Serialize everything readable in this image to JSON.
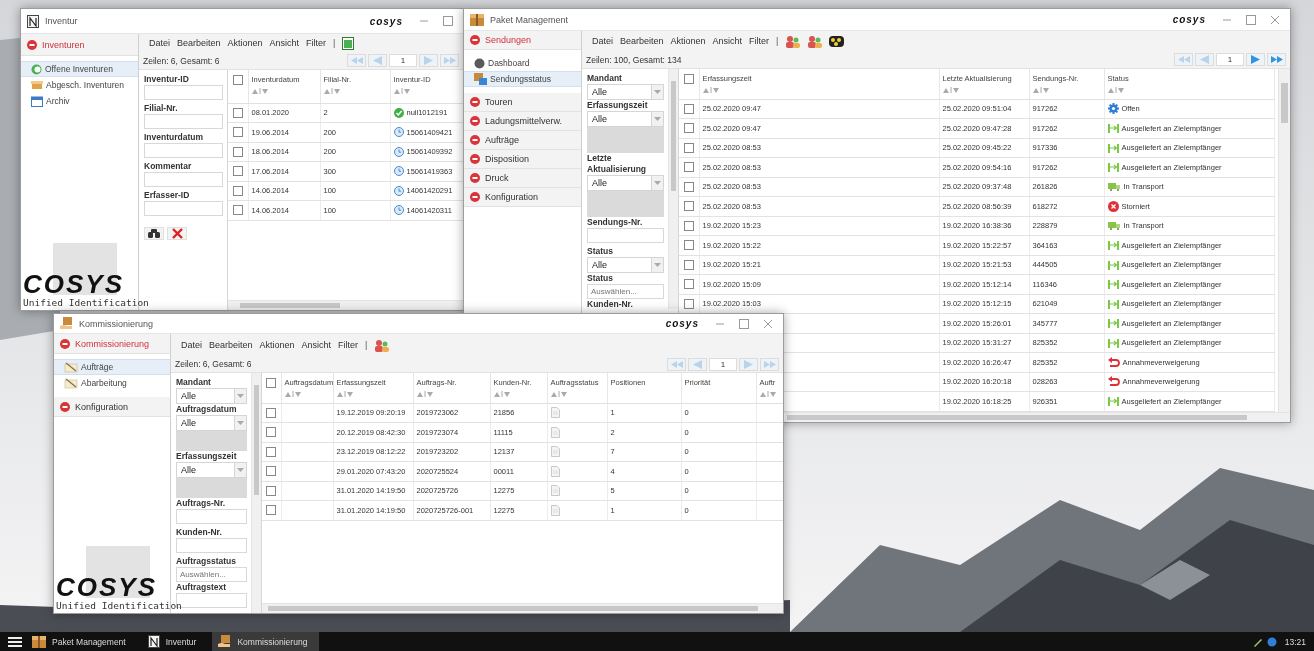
{
  "inventur_window": {
    "title": "Inventur",
    "kind": "inventory",
    "brand": "cosys",
    "controls": [
      {
        "kind": "minimize"
      },
      {
        "kind": "maximize"
      }
    ],
    "sidebar": {
      "sections": [
        {
          "label": "Inventuren",
          "active": true,
          "items": [
            {
              "label": "Offene Inventuren",
              "kind": "open",
              "selected": true
            },
            {
              "label": "Abgesch. Inventuren",
              "kind": "closed",
              "selected": false
            },
            {
              "label": "Archiv",
              "kind": "archive",
              "selected": false
            }
          ]
        }
      ],
      "logo": "COSYS",
      "tagline": "Unified Identification"
    },
    "menu": [
      "Datei",
      "Bearbeiten",
      "Aktionen",
      "Ansicht",
      "Filter"
    ],
    "menu_separator": "|",
    "toolbar": [
      {
        "kind": "spreadsheet"
      }
    ],
    "row_count": "Zeilen: 6, Gesamt: 6",
    "pager": {
      "page": "1",
      "back_enabled": false,
      "forward_enabled": false
    },
    "filters": [
      {
        "label": "Inventur-ID",
        "kind": "text"
      },
      {
        "label": "Filial-Nr.",
        "kind": "text"
      },
      {
        "label": "Inventurdatum",
        "kind": "text"
      },
      {
        "label": "Kommentar",
        "kind": "text"
      },
      {
        "label": "Erfasser-ID",
        "kind": "text"
      }
    ],
    "filter_actions": [
      {
        "kind": "search"
      },
      {
        "kind": "clear"
      }
    ],
    "table": {
      "all_checked": false,
      "columns": [
        {
          "label": "Inventurdatum",
          "sortable": true
        },
        {
          "label": "Filial-Nr.",
          "sortable": true
        },
        {
          "label": "Inventur-ID",
          "sortable": true
        }
      ],
      "rows": [
        {
          "checked": false,
          "inventurdatum": "08.01.2020",
          "filial_nr": "2",
          "inventur_id": {
            "text": "null1012191",
            "kind": "done"
          }
        },
        {
          "checked": false,
          "inventurdatum": "19.06.2014",
          "filial_nr": "200",
          "inventur_id": {
            "text": "15061409421",
            "kind": "pending"
          }
        },
        {
          "checked": false,
          "inventurdatum": "18.06.2014",
          "filial_nr": "200",
          "inventur_id": {
            "text": "15061409392",
            "kind": "pending"
          }
        },
        {
          "checked": false,
          "inventurdatum": "17.06.2014",
          "filial_nr": "300",
          "inventur_id": {
            "text": "15061419363",
            "kind": "pending"
          }
        },
        {
          "checked": false,
          "inventurdatum": "14.06.2014",
          "filial_nr": "100",
          "inventur_id": {
            "text": "14061420291",
            "kind": "pending"
          }
        },
        {
          "checked": false,
          "inventurdatum": "14.06.2014",
          "filial_nr": "100",
          "inventur_id": {
            "text": "14061420311",
            "kind": "pending"
          }
        }
      ]
    }
  },
  "paket_window": {
    "title": "Paket Management",
    "kind": "package",
    "brand": "cosys",
    "controls": [
      {
        "kind": "minimize"
      },
      {
        "kind": "maximize"
      },
      {
        "kind": "close"
      }
    ],
    "sidebar": {
      "sections": [
        {
          "label": "Sendungen",
          "active": true,
          "items": [
            {
              "label": "Dashboard",
              "kind": "dashboard",
              "selected": false
            },
            {
              "label": "Sendungsstatus",
              "kind": "status",
              "selected": true
            }
          ]
        },
        {
          "label": "Touren",
          "active": false
        },
        {
          "label": "Ladungsmittelverw.",
          "active": false
        },
        {
          "label": "Aufträge",
          "active": false
        },
        {
          "label": "Disposition",
          "active": false
        },
        {
          "label": "Druck",
          "active": false
        },
        {
          "label": "Konfiguration",
          "active": false
        }
      ]
    },
    "menu": [
      "Datei",
      "Bearbeiten",
      "Aktionen",
      "Ansicht",
      "Filter"
    ],
    "menu_separator": "|",
    "toolbar": [
      {
        "kind": "group"
      },
      {
        "kind": "group"
      },
      {
        "kind": "palette"
      }
    ],
    "row_count": "Zeilen: 100, Gesamt: 134",
    "pager": {
      "page": "1",
      "back_enabled": false,
      "forward_enabled": true
    },
    "filters": [
      {
        "label": "Mandant",
        "kind": "select",
        "value": "Alle"
      },
      {
        "label": "Erfassungszeit",
        "kind": "select_range",
        "value": "Alle"
      },
      {
        "label": "Letzte Aktualisierung",
        "kind": "select_range",
        "value": "Alle"
      },
      {
        "label": "Sendungs-Nr.",
        "kind": "text"
      },
      {
        "label": "Status",
        "kind": "select",
        "value": "Alle"
      },
      {
        "label": "Status",
        "kind": "multi",
        "placeholder": "Auswählen..."
      },
      {
        "label": "Kunden-Nr.",
        "kind": "heading"
      }
    ],
    "table": {
      "all_checked": false,
      "columns": [
        {
          "label": "Erfassungszeit",
          "sortable": true
        },
        {
          "label": "Letzte Aktualisierung",
          "sortable": true
        },
        {
          "label": "Sendungs-Nr.",
          "sortable": true
        },
        {
          "label": "Status",
          "sortable": true
        }
      ],
      "rows": [
        {
          "checked": false,
          "erfassungszeit": "25.02.2020 09:47",
          "letzte_aktualisierung": "25.02.2020 09:51:04",
          "sendungs_nr": "917262",
          "status": {
            "text": "Offen",
            "kind": "open"
          }
        },
        {
          "checked": false,
          "erfassungszeit": "25.02.2020 09:47",
          "letzte_aktualisierung": "25.02.2020 09:47:28",
          "sendungs_nr": "917262",
          "status": {
            "text": "Ausgeliefert an Zielempfänger",
            "kind": "delivered"
          }
        },
        {
          "checked": false,
          "erfassungszeit": "25.02.2020 08:53",
          "letzte_aktualisierung": "25.02.2020 09:45:22",
          "sendungs_nr": "917336",
          "status": {
            "text": "Ausgeliefert an Zielempfänger",
            "kind": "delivered"
          }
        },
        {
          "checked": false,
          "erfassungszeit": "25.02.2020 08:53",
          "letzte_aktualisierung": "25.02.2020 09:54:16",
          "sendungs_nr": "917262",
          "status": {
            "text": "Ausgeliefert an Zielempfänger",
            "kind": "delivered"
          }
        },
        {
          "checked": false,
          "erfassungszeit": "25.02.2020 08:53",
          "letzte_aktualisierung": "25.02.2020 09:37:48",
          "sendungs_nr": "261826",
          "status": {
            "text": "In Transport",
            "kind": "transport"
          }
        },
        {
          "checked": false,
          "erfassungszeit": "25.02.2020 08:53",
          "letzte_aktualisierung": "25.02.2020 08:56:39",
          "sendungs_nr": "618272",
          "status": {
            "text": "Storniert",
            "kind": "cancelled"
          }
        },
        {
          "checked": false,
          "erfassungszeit": "19.02.2020 15:23",
          "letzte_aktualisierung": "19.02.2020 16:38:36",
          "sendungs_nr": "228879",
          "status": {
            "text": "In Transport",
            "kind": "transport"
          }
        },
        {
          "checked": false,
          "erfassungszeit": "19.02.2020 15:22",
          "letzte_aktualisierung": "19.02.2020 15:22:57",
          "sendungs_nr": "364163",
          "status": {
            "text": "Ausgeliefert an Zielempfänger",
            "kind": "delivered"
          }
        },
        {
          "checked": false,
          "erfassungszeit": "19.02.2020 15:21",
          "letzte_aktualisierung": "19.02.2020 15:21:53",
          "sendungs_nr": "444505",
          "status": {
            "text": "Ausgeliefert an Zielempfänger",
            "kind": "delivered"
          }
        },
        {
          "checked": false,
          "erfassungszeit": "19.02.2020 15:09",
          "letzte_aktualisierung": "19.02.2020 15:12:14",
          "sendungs_nr": "116346",
          "status": {
            "text": "Ausgeliefert an Zielempfänger",
            "kind": "delivered"
          }
        },
        {
          "checked": false,
          "erfassungszeit": "19.02.2020 15:03",
          "letzte_aktualisierung": "19.02.2020 15:12:15",
          "sendungs_nr": "621049",
          "status": {
            "text": "Ausgeliefert an Zielempfänger",
            "kind": "delivered"
          }
        },
        {
          "letzte_aktualisierung": "19.02.2020 15:26:01",
          "sendungs_nr": "345777",
          "status": {
            "text": "Ausgeliefert an Zielempfänger",
            "kind": "delivered"
          }
        },
        {
          "letzte_aktualisierung": "19.02.2020 15:31:27",
          "sendungs_nr": "825352",
          "status": {
            "text": "Ausgeliefert an Zielempfänger",
            "kind": "delivered"
          }
        },
        {
          "letzte_aktualisierung": "19.02.2020 16:26:47",
          "sendungs_nr": "825352",
          "status": {
            "text": "Annahmeverweigerung",
            "kind": "refused"
          }
        },
        {
          "letzte_aktualisierung": "19.02.2020 16:20:18",
          "sendungs_nr": "028263",
          "status": {
            "text": "Annahmeverweigerung",
            "kind": "refused"
          }
        },
        {
          "letzte_aktualisierung": "19.02.2020 16:18:25",
          "sendungs_nr": "926351",
          "status": {
            "text": "Ausgeliefert an Zielempfänger",
            "kind": "delivered"
          }
        }
      ]
    }
  },
  "kommissionierung_window": {
    "title": "Kommissionierung",
    "kind": "picking",
    "brand": "cosys",
    "controls": [
      {
        "kind": "minimize"
      },
      {
        "kind": "maximize"
      },
      {
        "kind": "close"
      }
    ],
    "sidebar": {
      "sections": [
        {
          "label": "Kommissionierung",
          "active": true,
          "items": [
            {
              "label": "Aufträge",
              "kind": "list",
              "selected": true
            },
            {
              "label": "Abarbeitung",
              "kind": "list",
              "selected": false
            }
          ]
        },
        {
          "label": "Konfiguration",
          "active": false
        }
      ],
      "logo": "COSYS",
      "tagline": "Unified Identification"
    },
    "menu": [
      "Datei",
      "Bearbeiten",
      "Aktionen",
      "Ansicht",
      "Filter"
    ],
    "menu_separator": "|",
    "toolbar": [
      {
        "kind": "group"
      }
    ],
    "row_count": "Zeilen: 6, Gesamt: 6",
    "pager": {
      "page": "1",
      "back_enabled": false,
      "forward_enabled": false
    },
    "filters": [
      {
        "label": "Mandant",
        "kind": "select",
        "value": "Alle"
      },
      {
        "label": "Auftragsdatum",
        "kind": "select_range",
        "value": "Alle"
      },
      {
        "label": "Erfassungszeit",
        "kind": "select_range",
        "value": "Alle"
      },
      {
        "label": "Auftrags-Nr.",
        "kind": "text"
      },
      {
        "label": "Kunden-Nr.",
        "kind": "text"
      },
      {
        "label": "Auftragsstatus",
        "kind": "multi",
        "placeholder": "Auswählen..."
      },
      {
        "label": "Auftragstext",
        "kind": "text"
      }
    ],
    "table": {
      "all_checked": false,
      "columns": [
        {
          "label": "Auftragsdatum",
          "sortable": true
        },
        {
          "label": "Erfassungszeit",
          "sortable": true
        },
        {
          "label": "Auftrags-Nr.",
          "sortable": true
        },
        {
          "label": "Kunden-Nr.",
          "sortable": true
        },
        {
          "label": "Auftragsstatus",
          "sortable": true
        },
        {
          "label": "Positionen",
          "sortable": false
        },
        {
          "label": "Priorität",
          "sortable": false
        },
        {
          "label": "Auftr",
          "sortable": true
        }
      ],
      "rows": [
        {
          "checked": false,
          "erfassungszeit": "19.12.2019 09:20:19",
          "auftrags_nr": "2019723062",
          "kunden_nr": "21856",
          "auftragsstatus": {
            "kind": "document"
          },
          "positionen": "1",
          "prioritaet": "0"
        },
        {
          "checked": false,
          "erfassungszeit": "20.12.2019 08:42:30",
          "auftrags_nr": "2019723074",
          "kunden_nr": "11115",
          "auftragsstatus": {
            "kind": "document"
          },
          "positionen": "2",
          "prioritaet": "0"
        },
        {
          "checked": false,
          "erfassungszeit": "23.12.2019 08:12:22",
          "auftrags_nr": "2019723202",
          "kunden_nr": "12137",
          "auftragsstatus": {
            "kind": "document"
          },
          "positionen": "7",
          "prioritaet": "0"
        },
        {
          "checked": false,
          "erfassungszeit": "29.01.2020 07:43:20",
          "auftrags_nr": "2020725524",
          "kunden_nr": "00011",
          "auftragsstatus": {
            "kind": "document"
          },
          "positionen": "4",
          "prioritaet": "0"
        },
        {
          "checked": false,
          "erfassungszeit": "31.01.2020 14:19:50",
          "auftrags_nr": "2020725726",
          "kunden_nr": "12275",
          "auftragsstatus": {
            "kind": "document"
          },
          "positionen": "5",
          "prioritaet": "0"
        },
        {
          "checked": false,
          "erfassungszeit": "31.01.2020 14:19:50",
          "auftrags_nr": "2020725726-001",
          "kunden_nr": "12275",
          "auftragsstatus": {
            "kind": "document"
          },
          "positionen": "1",
          "prioritaet": "0"
        }
      ]
    }
  },
  "taskbar": {
    "items": [
      {
        "label": "Paket Management",
        "kind": "package",
        "selected": false
      },
      {
        "label": "Inventur",
        "kind": "inventory",
        "selected": false
      },
      {
        "label": "Kommissionierung",
        "kind": "picking",
        "selected": true
      }
    ],
    "clock": "13:21"
  }
}
